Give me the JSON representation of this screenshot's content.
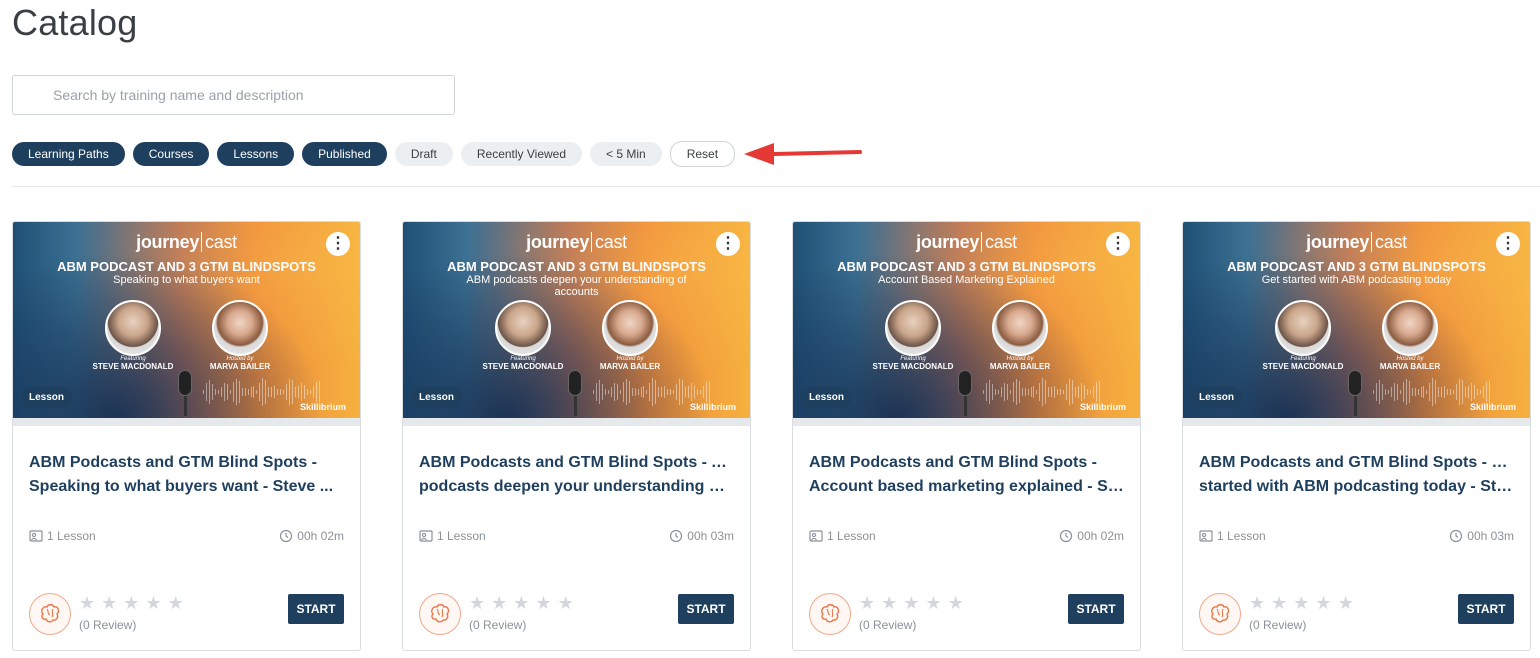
{
  "page": {
    "title": "Catalog"
  },
  "search": {
    "placeholder": "Search by training name and description"
  },
  "filters": [
    {
      "label": "Learning Paths",
      "state": "active"
    },
    {
      "label": "Courses",
      "state": "active"
    },
    {
      "label": "Lessons",
      "state": "active"
    },
    {
      "label": "Published",
      "state": "active"
    },
    {
      "label": "Draft",
      "state": "inactive"
    },
    {
      "label": "Recently Viewed",
      "state": "inactive"
    },
    {
      "label": "< 5 Min",
      "state": "inactive"
    },
    {
      "label": "Reset",
      "state": "reset"
    }
  ],
  "colors": {
    "accent": "#1e3f5e",
    "annotation_arrow": "#e53935"
  },
  "cards": [
    {
      "banner": {
        "brand_bold": "journey",
        "brand_light": "cast",
        "title": "ABM PODCAST AND 3 GTM BLINDSPOTS",
        "subtitle": "Speaking to what buyers want",
        "featuring": "Featuring",
        "guest": "STEVE MACDONALD",
        "hosted": "Hosted by",
        "host": "MARVA BAILER",
        "logo": "Skillibrium"
      },
      "badge": "Lesson",
      "title_line1": " ABM Podcasts and GTM Blind Spots -",
      "title_line2": "Speaking to what buyers want - Steve ...",
      "lessons": "1 Lesson",
      "duration": "00h 02m",
      "reviews": "(0 Review)",
      "rating": 0,
      "start": "START"
    },
    {
      "banner": {
        "brand_bold": "journey",
        "brand_light": "cast",
        "title": "ABM PODCAST AND 3 GTM BLINDSPOTS",
        "subtitle": "ABM podcasts deepen your understanding of accounts",
        "featuring": "Featuring",
        "guest": "STEVE MACDONALD",
        "hosted": "Hosted by",
        "host": "MARVA BAILER",
        "logo": "Skillibrium"
      },
      "badge": "Lesson",
      "title_line1": "ABM Podcasts and GTM Blind Spots - ABM",
      "title_line2": "podcasts deepen your understanding of ...",
      "lessons": "1 Lesson",
      "duration": "00h 03m",
      "reviews": "(0 Review)",
      "rating": 0,
      "start": "START"
    },
    {
      "banner": {
        "brand_bold": "journey",
        "brand_light": "cast",
        "title": "ABM PODCAST AND 3 GTM BLINDSPOTS",
        "subtitle": "Account Based Marketing Explained",
        "featuring": "Featuring",
        "guest": "STEVE MACDONALD",
        "hosted": "Hosted by",
        "host": "MARVA BAILER",
        "logo": "Skillibrium"
      },
      "badge": "Lesson",
      "title_line1": "ABM Podcasts and GTM Blind Spots -",
      "title_line2": "Account based marketing explained - Stev...",
      "lessons": "1 Lesson",
      "duration": "00h 02m",
      "reviews": "(0 Review)",
      "rating": 0,
      "start": "START"
    },
    {
      "banner": {
        "brand_bold": "journey",
        "brand_light": "cast",
        "title": "ABM PODCAST AND 3 GTM BLINDSPOTS",
        "subtitle": "Get started with ABM podcasting today",
        "featuring": "Featuring",
        "guest": "STEVE MACDONALD",
        "hosted": "Hosted by",
        "host": "MARVA BAILER",
        "logo": "Skillibrium"
      },
      "badge": "Lesson",
      "title_line1": "ABM Podcasts and GTM Blind Spots - Get",
      "title_line2": "started with ABM podcasting today - Steve ...",
      "lessons": "1 Lesson",
      "duration": "00h 03m",
      "reviews": "(0 Review)",
      "rating": 0,
      "start": "START"
    }
  ]
}
